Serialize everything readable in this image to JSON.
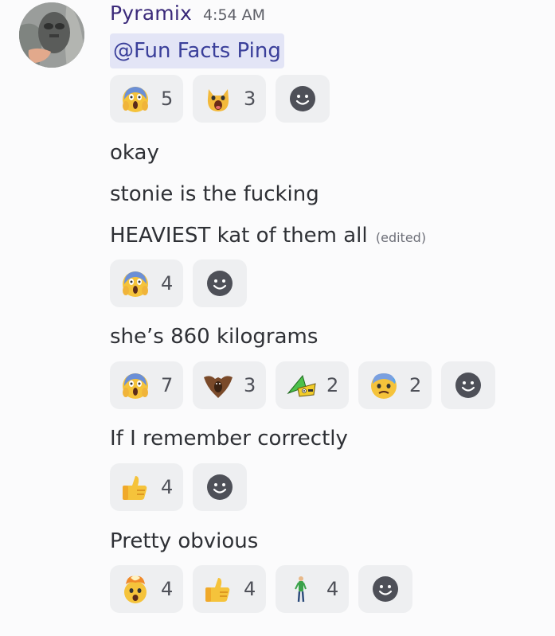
{
  "message": {
    "username": "Pyramix",
    "timestamp": "4:54 AM",
    "mention": "@Fun Facts Ping",
    "lines": [
      {
        "text": "okay"
      },
      {
        "text": "stonie is the fucking"
      },
      {
        "text": "HEAVIEST kat of them all",
        "edited": "(edited)"
      },
      {
        "text": "she’s 860 kilograms"
      },
      {
        "text": "If I remember correctly"
      },
      {
        "text": "Pretty obvious"
      }
    ]
  },
  "reaction_groups": [
    {
      "reactions": [
        {
          "emoji": "scream-face-icon",
          "count": "5"
        },
        {
          "emoji": "surprised-cat-icon",
          "count": "3"
        }
      ]
    },
    {
      "reactions": [
        {
          "emoji": "scream-face-icon",
          "count": "4"
        }
      ]
    },
    {
      "reactions": [
        {
          "emoji": "scream-face-icon",
          "count": "7"
        },
        {
          "emoji": "brown-bat-icon",
          "count": "3"
        },
        {
          "emoji": "green-pyramid-icon",
          "count": "2"
        },
        {
          "emoji": "anxious-face-icon",
          "count": "2"
        }
      ]
    },
    {
      "reactions": [
        {
          "emoji": "thumbs-up-icon",
          "count": "4"
        }
      ]
    },
    {
      "reactions": [
        {
          "emoji": "exploding-head-icon",
          "count": "4"
        },
        {
          "emoji": "thumbs-up-icon",
          "count": "4"
        },
        {
          "emoji": "standing-person-icon",
          "count": "4"
        }
      ]
    }
  ],
  "colors": {
    "background": "#fbfbfc",
    "username": "#3b2a7a",
    "mention_bg": "#e3e5f6",
    "mention_text": "#3a3f9a",
    "reaction_bg": "#eeeff1"
  }
}
